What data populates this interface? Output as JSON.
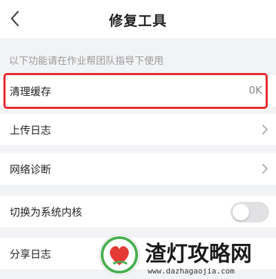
{
  "header": {
    "title": "修复工具",
    "back_icon": "chevron-left-icon"
  },
  "hint": "以下功能请在作业帮团队指导下使用",
  "rows": [
    {
      "label": "清理缓存",
      "value": "0K"
    },
    {
      "label": "上传日志",
      "icon": "chevron-right-icon"
    },
    {
      "label": "网络诊断",
      "icon": "chevron-right-icon"
    },
    {
      "label": "切换为系统内核",
      "toggle_on": false
    },
    {
      "label": "分享日志"
    }
  ],
  "highlight_color": "#e8262b",
  "watermark": {
    "title": "渣灯攻略网",
    "url": "www.dazhagaojia.com"
  }
}
